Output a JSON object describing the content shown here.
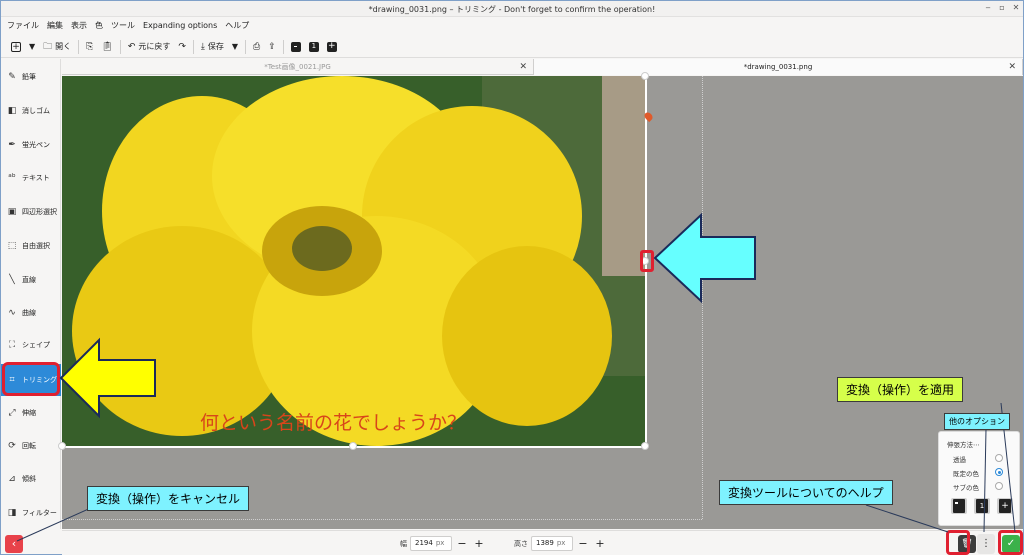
{
  "window": {
    "title": "*drawing_0031.png – トリミング - Don't forget to confirm the operation!",
    "controls": {
      "minimize": "‒",
      "maximize": "▫",
      "close": "✕"
    }
  },
  "menu": [
    "ファイル",
    "編集",
    "表示",
    "色",
    "ツール",
    "Expanding options",
    "ヘルプ"
  ],
  "toolbar": {
    "open_label": "開く",
    "undo_label": "元に戻す",
    "save_label": "保存"
  },
  "sidebar": {
    "items": [
      {
        "label": "鉛筆",
        "icon": "pencil-icon",
        "glyph": "✎"
      },
      {
        "label": "消しゴム",
        "icon": "eraser-icon",
        "glyph": "◧"
      },
      {
        "label": "蛍光ペン",
        "icon": "highlighter-icon",
        "glyph": "✒"
      },
      {
        "label": "テキスト",
        "icon": "text-icon",
        "glyph": "ᵃᵇ"
      },
      {
        "label": "四辺形選択",
        "icon": "rect-select-icon",
        "glyph": "▣"
      },
      {
        "label": "自由選択",
        "icon": "free-select-icon",
        "glyph": "⬚"
      },
      {
        "label": "直線",
        "icon": "line-icon",
        "glyph": "╲"
      },
      {
        "label": "曲線",
        "icon": "curve-icon",
        "glyph": "∿"
      },
      {
        "label": "シェイプ",
        "icon": "shape-icon",
        "glyph": "⛶"
      },
      {
        "label": "トリミング",
        "icon": "crop-icon",
        "glyph": "⌗"
      },
      {
        "label": "伸縮",
        "icon": "scale-icon",
        "glyph": "⤢"
      },
      {
        "label": "回転",
        "icon": "rotate-icon",
        "glyph": "⟳"
      },
      {
        "label": "傾斜",
        "icon": "skew-icon",
        "glyph": "⊿"
      },
      {
        "label": "フィルター",
        "icon": "filter-icon",
        "glyph": "◨"
      }
    ],
    "active_index": 9,
    "back_glyph": "‹"
  },
  "tabs": [
    {
      "label": "*Test画像_0021.JPG",
      "close": "✕"
    },
    {
      "label": "*drawing_0031.png",
      "close": "✕"
    }
  ],
  "canvas": {
    "caption": "何という名前の花でしょうか？"
  },
  "bottom": {
    "width_label": "幅",
    "width_value": "2194",
    "height_label": "高さ",
    "height_value": "1389",
    "unit": "px",
    "minus": "−",
    "plus": "+"
  },
  "options_popup": {
    "header": "伸張方法⋯",
    "rows": [
      "透過",
      "既定の色",
      "サブの色"
    ],
    "selected_index": 1,
    "buttons": [
      "−",
      "1",
      "+"
    ]
  },
  "actions": {
    "cancel_glyph": "🗑",
    "help_glyph": "⋮",
    "apply_glyph": "✓"
  },
  "annotations": {
    "apply": "変換（操作）を適用",
    "other_options": "他のオプション",
    "help": "変換ツールについてのヘルプ",
    "cancel": "変換（操作）をキャンセル"
  },
  "colors": {
    "accent": "#2d8ad8",
    "highlight_red": "#e02030",
    "callout_cyan": "#7ef2ff",
    "callout_green": "#d6ff4a",
    "arrow_yellow": "#ffff00",
    "arrow_cyan": "#66ffff",
    "caption_orange": "#d8451a"
  }
}
